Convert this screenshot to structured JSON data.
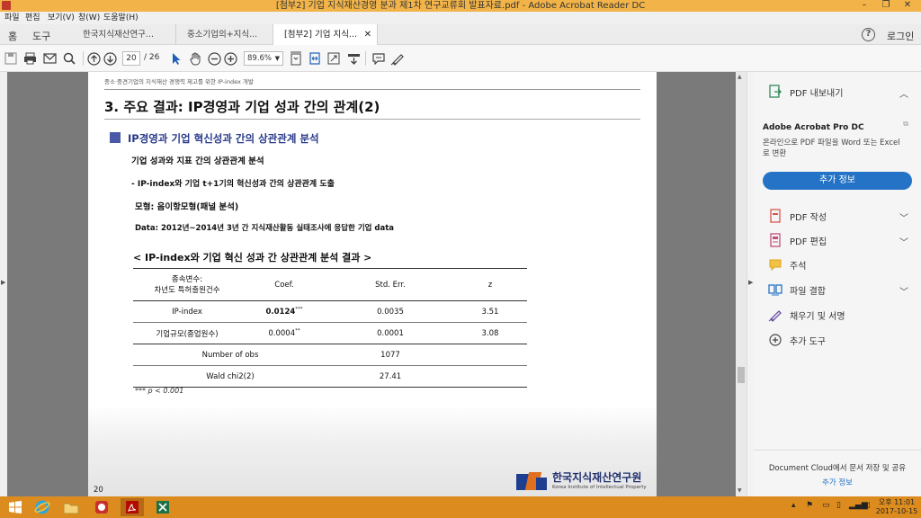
{
  "window": {
    "title": "[첨부2] 기업 지식재산경영 분과 제1차 연구교류회 발표자료.pdf - Adobe Acrobat Reader DC"
  },
  "menu": [
    "파일",
    "편집",
    "보기(V)",
    "창(W)",
    "도움말(H)"
  ],
  "nav": {
    "home": "홈",
    "tools": "도구",
    "login": "로그인",
    "help_icon": "?"
  },
  "tabs": [
    {
      "label": "한국지식재산연구..."
    },
    {
      "label": "중소기업의+지식..."
    },
    {
      "label": "[첨부2] 기업 지식...",
      "active": true
    }
  ],
  "toolbar": {
    "page_current": "20",
    "page_total": "/ 26",
    "zoom": "89.6%"
  },
  "document": {
    "header_small": "중소·중견기업의 지식재산 경쟁력 제고를 위한 IP-index 개발",
    "title": "3. 주요 결과: IP경영과 기업 성과 간의 관계(2)",
    "section": "IP경영과 기업 혁신성과 간의 상관관계 분석",
    "bullet1": "기업 성과와 지표 간의 상관관계 분석",
    "bullet2": "- IP-index와 기업 t+1기의 혁신성과 간의 상관관계 도출",
    "bullet3": "모형: 음이항모형(패널 분석)",
    "bullet4": "Data: 2012년~2014년 3년 간 지식재산활동 실태조사에 응답한 기업 data",
    "table_title": "< IP-index와 기업 혁신 성과 간 상관관계 분석 결과 >",
    "table": {
      "dep_line1": "종속변수:",
      "dep_line2": "차년도 특허출원건수",
      "col_coef": "Coef.",
      "col_se": "Std. Err.",
      "col_z": "z",
      "rows": [
        {
          "var": "IP-index",
          "coef": "0.0124",
          "stars": "***",
          "se": "0.0035",
          "z": "3.51"
        },
        {
          "var": "기업규모(종업원수)",
          "coef": "0.0004",
          "stars": "**",
          "se": "0.0001",
          "z": "3.08"
        }
      ],
      "obs_label": "Number of obs",
      "obs_value": "1077",
      "wald_label": "Wald chi2(2)",
      "wald_value": "27.41"
    },
    "note": "*** p < 0.001",
    "page_number": "20",
    "logo_ko": "한국지식재산연구원",
    "logo_en": "Korea Institute of Intellectual Property"
  },
  "panel": {
    "export": "PDF 내보내기",
    "pro_title": "Adobe Acrobat Pro DC",
    "pro_desc": "온라인으로 PDF 파일을 Word 또는 Excel 로 변환",
    "more_info_button": "추가 정보",
    "items": [
      "PDF 작성",
      "PDF 편집",
      "주석",
      "파일 결합",
      "채우기 및 서명",
      "추가 도구"
    ],
    "cloud_text": "Document Cloud에서 문서 저장 및 공유",
    "cloud_link": "추가 정보"
  },
  "taskbar": {
    "time": "오후 11:01",
    "date": "2017-10-15"
  },
  "colors": {
    "titlebar": "#f2b449",
    "taskbar": "#dc8c1f",
    "accent": "#2473c6",
    "section": "#2a3a8a"
  }
}
